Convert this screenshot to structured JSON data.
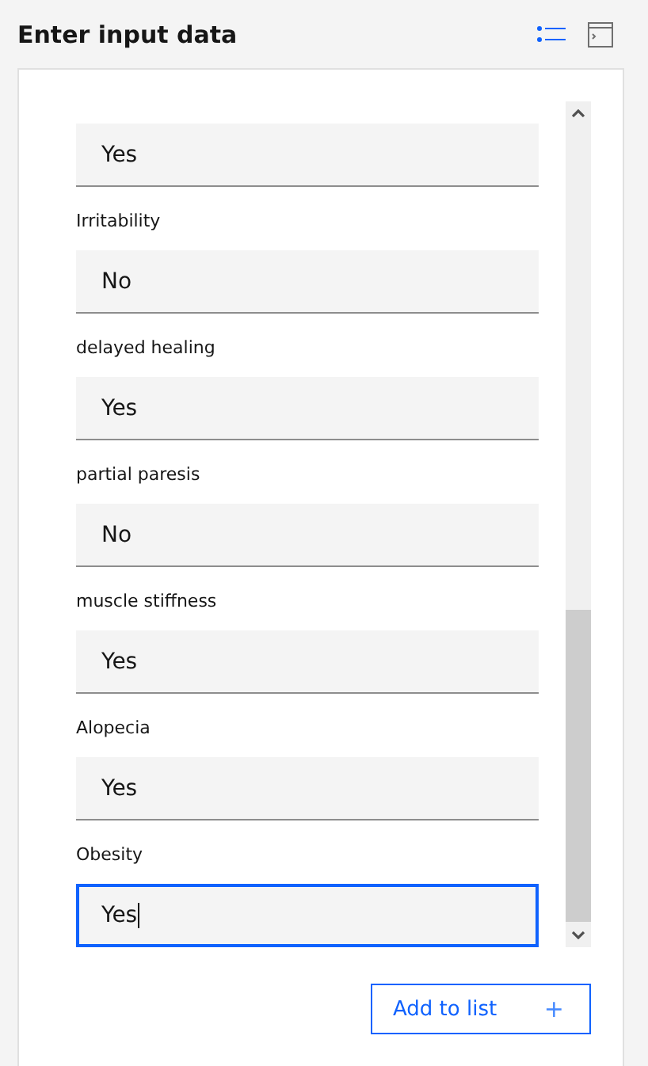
{
  "header": {
    "title": "Enter input data"
  },
  "fields": [
    {
      "value": "Yes",
      "focused": false
    },
    {
      "label": "Irritability",
      "value": "No",
      "focused": false
    },
    {
      "label": "delayed healing",
      "value": "Yes",
      "focused": false
    },
    {
      "label": "partial paresis",
      "value": "No",
      "focused": false
    },
    {
      "label": "muscle stiffness",
      "value": "Yes",
      "focused": false
    },
    {
      "label": "Alopecia",
      "value": "Yes",
      "focused": false
    },
    {
      "label": "Obesity",
      "value": "Yes",
      "focused": true
    }
  ],
  "add_button": {
    "label": "Add to list",
    "icon": "+"
  }
}
